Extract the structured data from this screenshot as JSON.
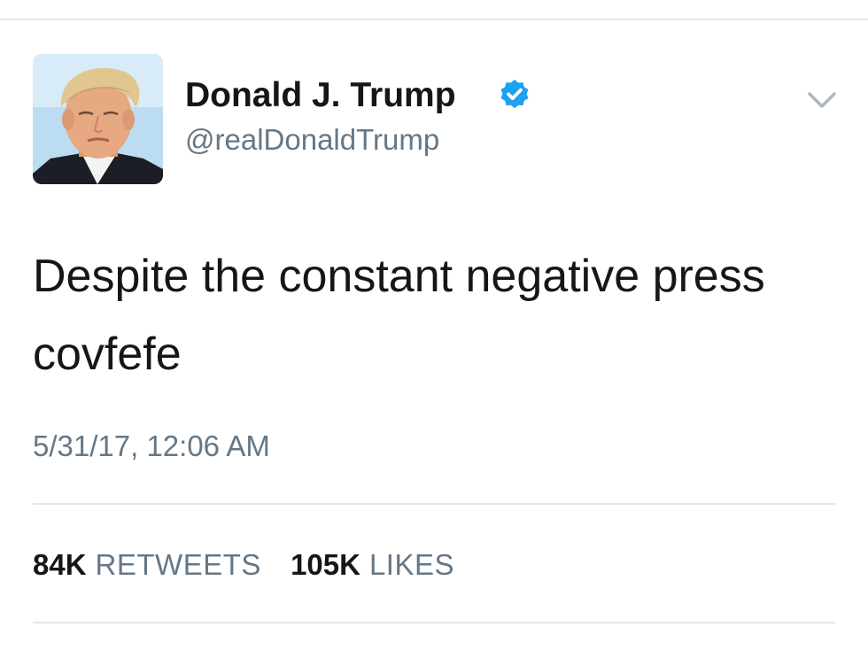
{
  "tweet": {
    "author": {
      "display_name": "Donald J. Trump",
      "handle": "@realDonaldTrump",
      "verified": true,
      "avatar_icon": "profile-photo"
    },
    "text": "Despite the constant negative press covfefe",
    "timestamp": "5/31/17, 12:06 AM",
    "stats": {
      "retweets_count": "84K",
      "retweets_label": "RETWEETS",
      "likes_count": "105K",
      "likes_label": "LIKES"
    },
    "menu_icon": "chevron-down-icon"
  },
  "colors": {
    "text_primary": "#14171a",
    "text_secondary": "#657786",
    "verified_blue": "#1da1f2",
    "divider": "#e1e8ed"
  }
}
